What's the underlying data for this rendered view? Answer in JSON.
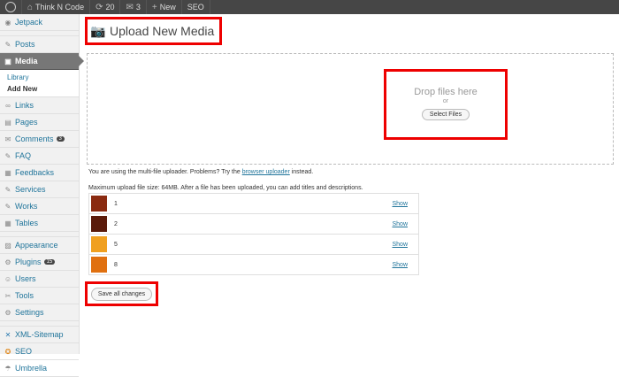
{
  "admin_bar": {
    "site_name": "Think N Code",
    "updates_count": "20",
    "comments_count": "3",
    "new_label": "New",
    "seo_label": "SEO"
  },
  "sidebar": {
    "items": [
      {
        "label": "Jetpack",
        "icon": "jetpack-icon"
      },
      {
        "label": "Posts",
        "icon": "pin-icon"
      },
      {
        "label": "Media",
        "icon": "media-icon",
        "active": true
      },
      {
        "label": "Links",
        "icon": "link-icon"
      },
      {
        "label": "Pages",
        "icon": "page-icon"
      },
      {
        "label": "Comments",
        "icon": "comment-icon",
        "badge": "3"
      },
      {
        "label": "FAQ",
        "icon": "faq-icon"
      },
      {
        "label": "Feedbacks",
        "icon": "feedback-icon"
      },
      {
        "label": "Services",
        "icon": "services-icon"
      },
      {
        "label": "Works",
        "icon": "works-icon"
      },
      {
        "label": "Tables",
        "icon": "table-icon"
      },
      {
        "label": "Appearance",
        "icon": "appearance-icon"
      },
      {
        "label": "Plugins",
        "icon": "plugin-icon",
        "badge": "15"
      },
      {
        "label": "Users",
        "icon": "users-icon"
      },
      {
        "label": "Tools",
        "icon": "tools-icon"
      },
      {
        "label": "Settings",
        "icon": "settings-icon"
      },
      {
        "label": "XML-Sitemap",
        "icon": "sitemap-icon"
      },
      {
        "label": "SEO",
        "icon": "seo-icon"
      },
      {
        "label": "Umbrella",
        "icon": "umbrella-icon"
      }
    ],
    "media_submenu": [
      "Library",
      "Add New"
    ]
  },
  "page": {
    "title": "Upload New Media"
  },
  "uploader": {
    "drop_text": "Drop files here",
    "or_text": "or",
    "select_button": "Select Files",
    "info_prefix": "You are using the multi-file uploader. Problems? Try the",
    "info_link": "browser uploader",
    "info_suffix": "instead.",
    "max_size_text": "Maximum upload file size: 64MB. After a file has been uploaded, you can add titles and descriptions."
  },
  "files": [
    {
      "name": "1",
      "show": "Show",
      "color": "#8a2a10"
    },
    {
      "name": "2",
      "show": "Show",
      "color": "#5a1a0a"
    },
    {
      "name": "5",
      "show": "Show",
      "color": "#f0a020"
    },
    {
      "name": "8",
      "show": "Show",
      "color": "#e07010"
    }
  ],
  "save_button": "Save all changes"
}
